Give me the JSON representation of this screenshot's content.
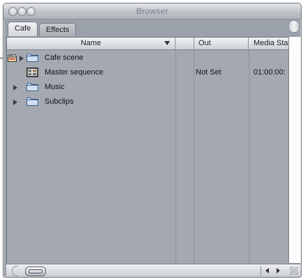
{
  "window": {
    "title": "Browser"
  },
  "tabs": [
    {
      "label": "Cafe",
      "active": true
    },
    {
      "label": "Effects",
      "active": false
    }
  ],
  "table": {
    "columns": [
      "Name",
      "",
      "Out",
      "Media Sta"
    ],
    "rows": [
      {
        "name": "Cafe scene",
        "type": "bin",
        "expandable": true,
        "out": "",
        "media_start": ""
      },
      {
        "name": "Master sequence",
        "type": "sequence",
        "expandable": false,
        "out": "Not Set",
        "media_start": "01:00:00:"
      },
      {
        "name": "Music",
        "type": "bin",
        "expandable": true,
        "out": "",
        "media_start": ""
      },
      {
        "name": "Subclips",
        "type": "bin",
        "expandable": true,
        "out": "",
        "media_start": ""
      }
    ]
  },
  "colors": {
    "list_background": "#a4a9b1",
    "folder": "#cfe0f3"
  }
}
